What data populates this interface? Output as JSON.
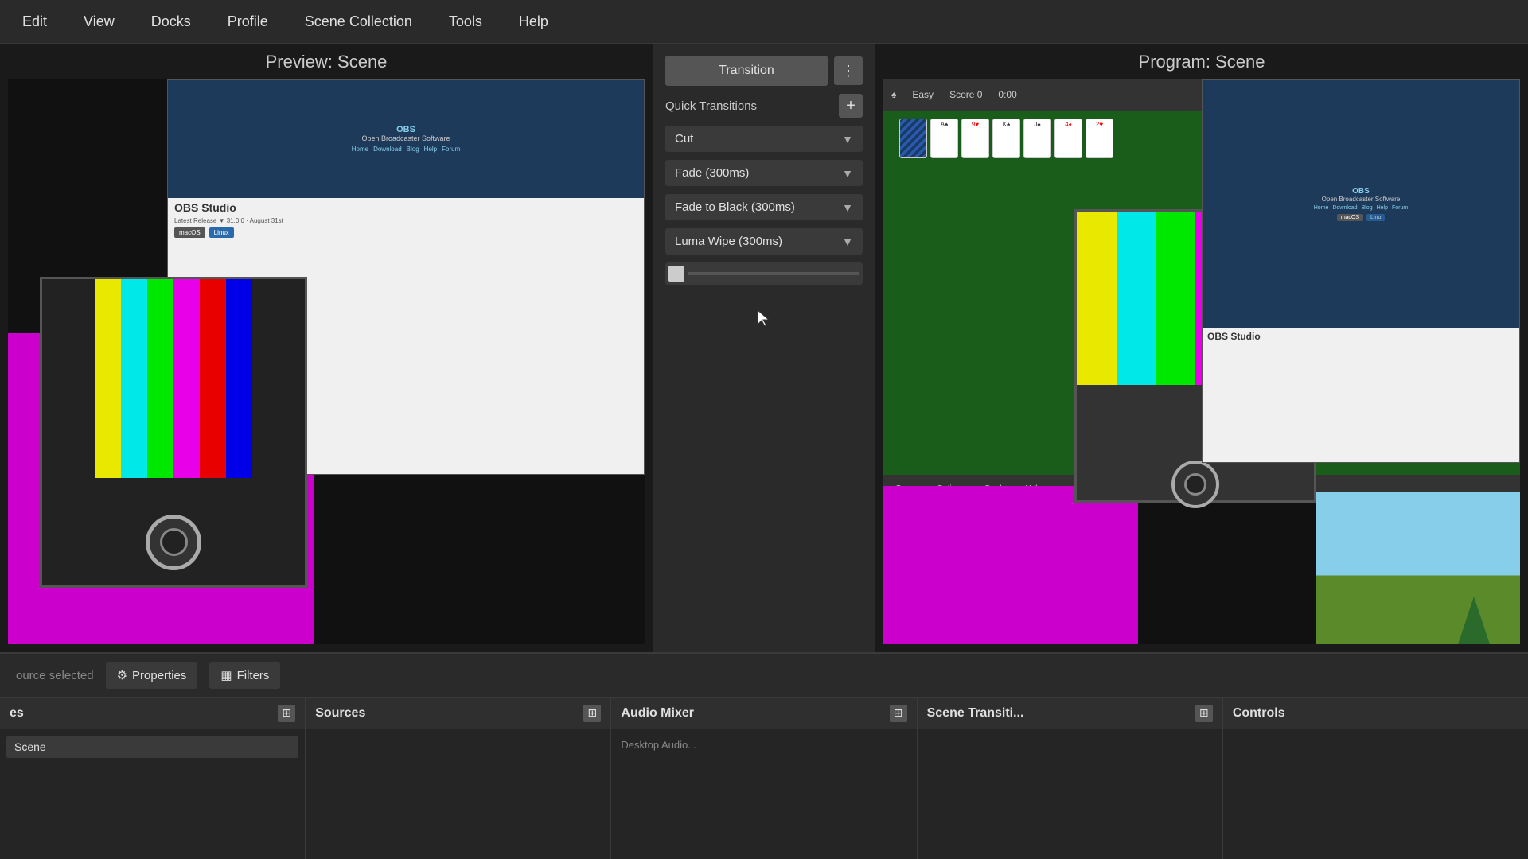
{
  "menubar": {
    "items": [
      "Edit",
      "View",
      "Docks",
      "Profile",
      "Scene Collection",
      "Tools",
      "Help"
    ]
  },
  "preview": {
    "title": "Preview: Scene"
  },
  "program": {
    "title": "Program: Scene"
  },
  "transition": {
    "button_label": "Transition",
    "menu_icon": "⋮",
    "quick_transitions_label": "Quick Transitions",
    "add_label": "+",
    "dropdowns": [
      {
        "label": "Cut"
      },
      {
        "label": "Fade (300ms)"
      },
      {
        "label": "Fade to Black (300ms)"
      },
      {
        "label": "Luma Wipe (300ms)"
      }
    ]
  },
  "bottom": {
    "source_text": "ource selected",
    "properties_label": "Properties",
    "filters_label": "Filters",
    "dock_panels": [
      {
        "title": "es",
        "id": "scenes"
      },
      {
        "title": "Sources",
        "id": "sources"
      },
      {
        "title": "Audio Mixer",
        "id": "audio"
      },
      {
        "title": "Scene Transiti...",
        "id": "scene-transitions"
      },
      {
        "title": "Controls",
        "id": "controls"
      }
    ]
  }
}
